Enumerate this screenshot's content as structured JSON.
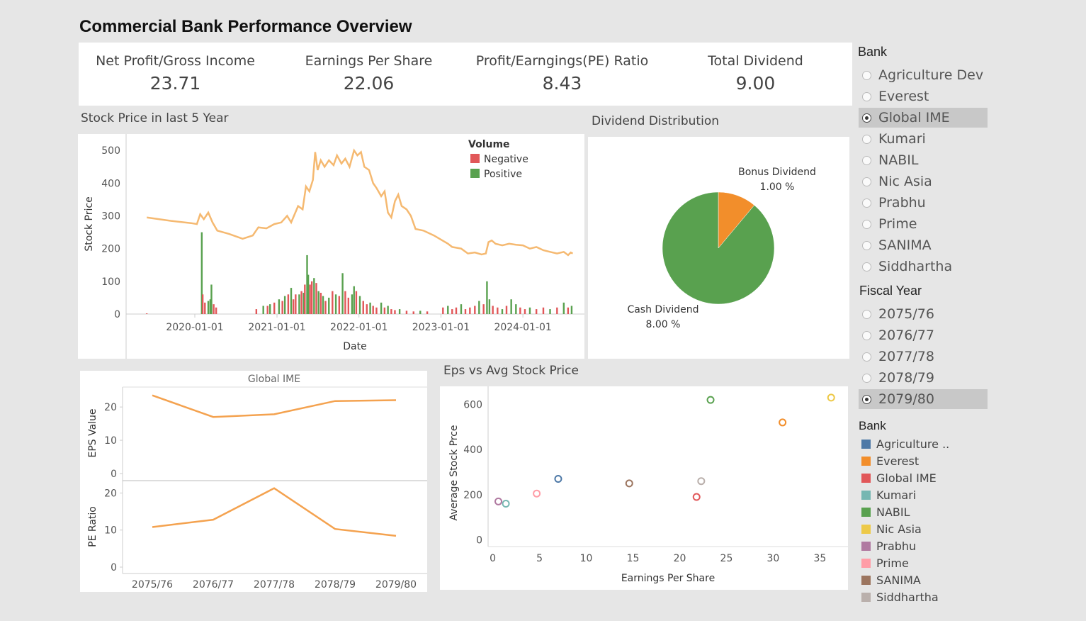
{
  "title": "Commercial Bank Performance Overview",
  "kpis": [
    {
      "label": "Net Profit/Gross Income",
      "value": "23.71"
    },
    {
      "label": "Earnings Per Share",
      "value": "22.06"
    },
    {
      "label": "Profit/Earngings(PE) Ratio",
      "value": "8.43"
    },
    {
      "label": "Total Dividend",
      "value": "9.00"
    }
  ],
  "stock_title": "Stock Price in last 5 Year",
  "dividend_title": "Dividend Distribution",
  "eps_scatter_title": "Eps vs Avg Stock Price",
  "bank_filter": {
    "title": "Bank",
    "options": [
      "Agriculture Dev",
      "Everest",
      "Global IME",
      "Kumari",
      "NABIL",
      "Nic Asia",
      "Prabhu",
      "Prime",
      "SANIMA",
      "Siddhartha"
    ],
    "selected": "Global IME"
  },
  "year_filter": {
    "title": "Fiscal Year",
    "options": [
      "2075/76",
      "2076/77",
      "2077/78",
      "2078/79",
      "2079/80"
    ],
    "selected": "2079/80"
  },
  "bank_legend": {
    "title": "Bank",
    "items": [
      {
        "label": "Agriculture ..",
        "color": "#4e79a7"
      },
      {
        "label": "Everest",
        "color": "#f28e2b"
      },
      {
        "label": "Global IME",
        "color": "#e15759"
      },
      {
        "label": "Kumari",
        "color": "#76b7b2"
      },
      {
        "label": "NABIL",
        "color": "#59a14f"
      },
      {
        "label": "Nic Asia",
        "color": "#edc948"
      },
      {
        "label": "Prabhu",
        "color": "#b07aa1"
      },
      {
        "label": "Prime",
        "color": "#ff9da7"
      },
      {
        "label": "SANIMA",
        "color": "#9c755f"
      },
      {
        "label": "Siddhartha",
        "color": "#bab0ac"
      }
    ]
  },
  "chart_data": [
    {
      "type": "line",
      "name": "stock",
      "xlabel": "Date",
      "ylabel": "Stock Price",
      "x_ticks": [
        "2020-01-01",
        "2021-01-01",
        "2022-01-01",
        "2023-01-01",
        "2024-01-01"
      ],
      "y_ticks": [
        0,
        100,
        200,
        300,
        400,
        500
      ],
      "ylim": [
        0,
        520
      ],
      "x_range": [
        "2019-03-01",
        "2024-10-01"
      ],
      "price_series": {
        "color": "#f5b971",
        "points": [
          [
            "2019-06-01",
            295
          ],
          [
            "2019-09-15",
            285
          ],
          [
            "2019-12-15",
            278
          ],
          [
            "2020-01-10",
            275
          ],
          [
            "2020-01-25",
            305
          ],
          [
            "2020-02-10",
            290
          ],
          [
            "2020-03-01",
            310
          ],
          [
            "2020-03-20",
            280
          ],
          [
            "2020-04-10",
            255
          ],
          [
            "2020-06-01",
            245
          ],
          [
            "2020-08-01",
            230
          ],
          [
            "2020-09-15",
            240
          ],
          [
            "2020-10-10",
            265
          ],
          [
            "2020-11-15",
            262
          ],
          [
            "2020-12-20",
            275
          ],
          [
            "2021-01-20",
            280
          ],
          [
            "2021-02-15",
            300
          ],
          [
            "2021-03-05",
            280
          ],
          [
            "2021-04-05",
            330
          ],
          [
            "2021-04-25",
            320
          ],
          [
            "2021-05-10",
            390
          ],
          [
            "2021-05-25",
            375
          ],
          [
            "2021-06-10",
            410
          ],
          [
            "2021-06-20",
            495
          ],
          [
            "2021-07-01",
            440
          ],
          [
            "2021-07-15",
            470
          ],
          [
            "2021-08-01",
            450
          ],
          [
            "2021-08-20",
            470
          ],
          [
            "2021-09-10",
            455
          ],
          [
            "2021-09-25",
            485
          ],
          [
            "2021-10-15",
            460
          ],
          [
            "2021-11-01",
            475
          ],
          [
            "2021-11-20",
            450
          ],
          [
            "2021-12-10",
            500
          ],
          [
            "2021-12-25",
            485
          ],
          [
            "2022-01-10",
            495
          ],
          [
            "2022-01-25",
            450
          ],
          [
            "2022-02-15",
            440
          ],
          [
            "2022-03-05",
            400
          ],
          [
            "2022-03-20",
            385
          ],
          [
            "2022-04-10",
            360
          ],
          [
            "2022-04-25",
            375
          ],
          [
            "2022-05-10",
            310
          ],
          [
            "2022-05-25",
            295
          ],
          [
            "2022-06-10",
            345
          ],
          [
            "2022-06-25",
            365
          ],
          [
            "2022-07-10",
            330
          ],
          [
            "2022-08-01",
            320
          ],
          [
            "2022-08-20",
            300
          ],
          [
            "2022-09-10",
            260
          ],
          [
            "2022-10-15",
            255
          ],
          [
            "2022-12-01",
            240
          ],
          [
            "2023-02-01",
            215
          ],
          [
            "2023-02-20",
            205
          ],
          [
            "2023-04-01",
            200
          ],
          [
            "2023-05-01",
            185
          ],
          [
            "2023-06-01",
            188
          ],
          [
            "2023-07-01",
            182
          ],
          [
            "2023-07-20",
            185
          ],
          [
            "2023-08-01",
            220
          ],
          [
            "2023-08-15",
            225
          ],
          [
            "2023-09-01",
            215
          ],
          [
            "2023-10-01",
            210
          ],
          [
            "2023-11-01",
            215
          ],
          [
            "2023-12-01",
            212
          ],
          [
            "2024-01-01",
            210
          ],
          [
            "2024-02-01",
            200
          ],
          [
            "2024-03-01",
            205
          ],
          [
            "2024-04-01",
            195
          ],
          [
            "2024-05-01",
            190
          ],
          [
            "2024-06-01",
            185
          ],
          [
            "2024-07-01",
            190
          ],
          [
            "2024-07-20",
            180
          ],
          [
            "2024-08-01",
            188
          ],
          [
            "2024-08-10",
            185
          ]
        ]
      },
      "volume_legend_title": "Volume",
      "volume_series": [
        {
          "name": "Negative",
          "color": "#e15759"
        },
        {
          "name": "Positive",
          "color": "#59a14f"
        }
      ],
      "volume_points": [
        [
          "2019-06-01",
          2,
          "Negative"
        ],
        [
          "2020-02-01",
          250,
          "Positive"
        ],
        [
          "2020-02-05",
          60,
          "Negative"
        ],
        [
          "2020-02-15",
          35,
          "Negative"
        ],
        [
          "2020-03-01",
          40,
          "Positive"
        ],
        [
          "2020-03-10",
          45,
          "Positive"
        ],
        [
          "2020-03-15",
          90,
          "Positive"
        ],
        [
          "2020-03-25",
          30,
          "Negative"
        ],
        [
          "2020-04-05",
          20,
          "Negative"
        ],
        [
          "2020-10-01",
          15,
          "Negative"
        ],
        [
          "2020-11-01",
          25,
          "Positive"
        ],
        [
          "2020-11-20",
          25,
          "Negative"
        ],
        [
          "2020-12-01",
          30,
          "Positive"
        ],
        [
          "2020-12-20",
          35,
          "Negative"
        ],
        [
          "2021-01-10",
          45,
          "Positive"
        ],
        [
          "2021-01-25",
          40,
          "Negative"
        ],
        [
          "2021-02-05",
          55,
          "Positive"
        ],
        [
          "2021-02-20",
          60,
          "Negative"
        ],
        [
          "2021-03-05",
          80,
          "Positive"
        ],
        [
          "2021-03-15",
          45,
          "Negative"
        ],
        [
          "2021-03-25",
          60,
          "Negative"
        ],
        [
          "2021-04-10",
          60,
          "Positive"
        ],
        [
          "2021-04-20",
          70,
          "Negative"
        ],
        [
          "2021-04-30",
          65,
          "Positive"
        ],
        [
          "2021-05-05",
          90,
          "Negative"
        ],
        [
          "2021-05-15",
          180,
          "Positive"
        ],
        [
          "2021-05-20",
          120,
          "Positive"
        ],
        [
          "2021-05-28",
          90,
          "Negative"
        ],
        [
          "2021-06-05",
          100,
          "Negative"
        ],
        [
          "2021-06-15",
          110,
          "Positive"
        ],
        [
          "2021-06-25",
          95,
          "Negative"
        ],
        [
          "2021-07-05",
          70,
          "Positive"
        ],
        [
          "2021-07-15",
          65,
          "Negative"
        ],
        [
          "2021-07-25",
          55,
          "Positive"
        ],
        [
          "2021-08-05",
          40,
          "Negative"
        ],
        [
          "2021-08-20",
          50,
          "Positive"
        ],
        [
          "2021-09-05",
          70,
          "Negative"
        ],
        [
          "2021-09-20",
          60,
          "Positive"
        ],
        [
          "2021-10-05",
          55,
          "Negative"
        ],
        [
          "2021-10-20",
          125,
          "Positive"
        ],
        [
          "2021-11-01",
          70,
          "Negative"
        ],
        [
          "2021-11-15",
          50,
          "Negative"
        ],
        [
          "2021-12-01",
          60,
          "Positive"
        ],
        [
          "2021-12-10",
          85,
          "Positive"
        ],
        [
          "2021-12-20",
          70,
          "Negative"
        ],
        [
          "2022-01-05",
          55,
          "Positive"
        ],
        [
          "2022-01-20",
          40,
          "Negative"
        ],
        [
          "2022-02-05",
          30,
          "Negative"
        ],
        [
          "2022-02-20",
          35,
          "Positive"
        ],
        [
          "2022-03-05",
          25,
          "Negative"
        ],
        [
          "2022-03-20",
          20,
          "Negative"
        ],
        [
          "2022-04-10",
          35,
          "Positive"
        ],
        [
          "2022-04-25",
          20,
          "Negative"
        ],
        [
          "2022-05-10",
          25,
          "Positive"
        ],
        [
          "2022-05-25",
          15,
          "Negative"
        ],
        [
          "2022-06-10",
          12,
          "Negative"
        ],
        [
          "2022-07-01",
          15,
          "Positive"
        ],
        [
          "2022-08-01",
          10,
          "Negative"
        ],
        [
          "2022-09-01",
          8,
          "Negative"
        ],
        [
          "2022-10-01",
          10,
          "Positive"
        ],
        [
          "2022-11-01",
          8,
          "Negative"
        ],
        [
          "2023-01-10",
          20,
          "Negative"
        ],
        [
          "2023-02-01",
          25,
          "Positive"
        ],
        [
          "2023-02-20",
          15,
          "Negative"
        ],
        [
          "2023-03-10",
          20,
          "Negative"
        ],
        [
          "2023-04-01",
          30,
          "Positive"
        ],
        [
          "2023-04-20",
          15,
          "Negative"
        ],
        [
          "2023-05-10",
          20,
          "Negative"
        ],
        [
          "2023-06-01",
          25,
          "Negative"
        ],
        [
          "2023-06-20",
          40,
          "Positive"
        ],
        [
          "2023-07-10",
          30,
          "Negative"
        ],
        [
          "2023-07-25",
          100,
          "Positive"
        ],
        [
          "2023-08-05",
          45,
          "Positive"
        ],
        [
          "2023-08-20",
          25,
          "Negative"
        ],
        [
          "2023-09-10",
          20,
          "Negative"
        ],
        [
          "2023-10-01",
          15,
          "Positive"
        ],
        [
          "2023-10-20",
          25,
          "Negative"
        ],
        [
          "2023-11-10",
          45,
          "Positive"
        ],
        [
          "2023-12-01",
          30,
          "Positive"
        ],
        [
          "2023-12-20",
          20,
          "Negative"
        ],
        [
          "2024-01-10",
          15,
          "Negative"
        ],
        [
          "2024-02-01",
          20,
          "Positive"
        ],
        [
          "2024-03-01",
          15,
          "Negative"
        ],
        [
          "2024-04-01",
          20,
          "Negative"
        ],
        [
          "2024-05-01",
          15,
          "Positive"
        ],
        [
          "2024-06-01",
          20,
          "Negative"
        ],
        [
          "2024-07-01",
          35,
          "Positive"
        ],
        [
          "2024-07-20",
          20,
          "Negative"
        ],
        [
          "2024-08-05",
          25,
          "Positive"
        ]
      ]
    },
    {
      "type": "pie",
      "name": "dividend",
      "slices": [
        {
          "label": "Bonus Dividend",
          "value_label": "1.00 %",
          "value": 1.0,
          "color": "#f28e2b"
        },
        {
          "label": "Cash Dividend",
          "value_label": "8.00 %",
          "value": 8.0,
          "color": "#59a14f"
        }
      ]
    },
    {
      "type": "line",
      "name": "eps_pe",
      "title": "Global IME",
      "categories": [
        "2075/76",
        "2076/77",
        "2077/78",
        "2078/79",
        "2079/80"
      ],
      "color": "#f4a24f",
      "panels": [
        {
          "ylabel": "EPS Value",
          "values": [
            23.5,
            17.0,
            17.8,
            21.8,
            22.06
          ],
          "y_ticks": [
            0,
            10,
            20
          ],
          "ylim": [
            0,
            24.5
          ]
        },
        {
          "ylabel": "PE Ratio",
          "values": [
            10.8,
            12.8,
            21.3,
            10.3,
            8.43
          ],
          "y_ticks": [
            0,
            10,
            20
          ],
          "ylim": [
            0,
            22
          ]
        }
      ]
    },
    {
      "type": "scatter",
      "name": "eps_scatter",
      "xlabel": "Earnings Per Share",
      "ylabel": "Average Stock Prce",
      "x_ticks": [
        0,
        5,
        10,
        15,
        20,
        25,
        30,
        35
      ],
      "y_ticks": [
        0,
        200,
        400,
        600
      ],
      "xlim": [
        -0.5,
        38
      ],
      "ylim": [
        -30,
        680
      ],
      "points": [
        {
          "bank": "Agriculture ..",
          "x": 7.0,
          "y": 270,
          "color": "#4e79a7"
        },
        {
          "bank": "Everest",
          "x": 31.0,
          "y": 520,
          "color": "#f28e2b"
        },
        {
          "bank": "Global IME",
          "x": 21.8,
          "y": 190,
          "color": "#e15759"
        },
        {
          "bank": "Kumari",
          "x": 1.4,
          "y": 160,
          "color": "#76b7b2"
        },
        {
          "bank": "NABIL",
          "x": 23.3,
          "y": 620,
          "color": "#59a14f"
        },
        {
          "bank": "Nic Asia",
          "x": 36.2,
          "y": 630,
          "color": "#edc948"
        },
        {
          "bank": "Prabhu",
          "x": 0.6,
          "y": 170,
          "color": "#b07aa1"
        },
        {
          "bank": "Prime",
          "x": 4.7,
          "y": 205,
          "color": "#ff9da7"
        },
        {
          "bank": "SANIMA",
          "x": 14.6,
          "y": 250,
          "color": "#9c755f"
        },
        {
          "bank": "Siddhartha",
          "x": 22.3,
          "y": 260,
          "color": "#bab0ac"
        }
      ]
    }
  ]
}
